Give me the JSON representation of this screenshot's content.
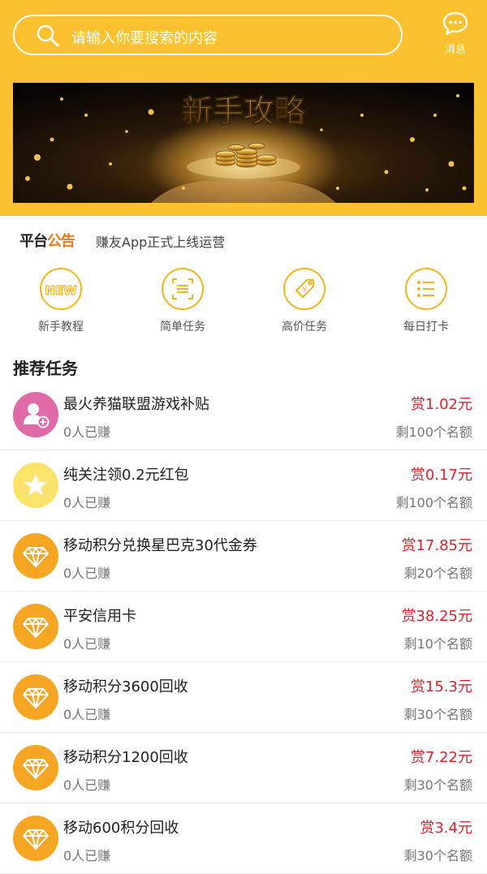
{
  "search": {
    "placeholder": "请输入你要搜索的内容"
  },
  "header": {
    "message_label": "消息"
  },
  "banner": {
    "title": "新手攻略"
  },
  "notice": {
    "logo_part1": "平台",
    "logo_part2": "公告",
    "text": "赚友App正式上线运营"
  },
  "quick_actions": [
    {
      "label": "新手教程",
      "icon": "new-icon"
    },
    {
      "label": "简单任务",
      "icon": "scan-icon"
    },
    {
      "label": "高价任务",
      "icon": "price-tag-icon"
    },
    {
      "label": "每日打卡",
      "icon": "list-icon"
    }
  ],
  "section": {
    "title": "推荐任务"
  },
  "tasks": [
    {
      "title": "最火养猫联盟游戏补贴",
      "earned": "0人已赚",
      "reward": "赏1.02元",
      "remaining": "剩100个名额",
      "icon": "add-user-icon",
      "icon_color": "#e06aa8"
    },
    {
      "title": "纯关注领0.2元红包",
      "earned": "0人已赚",
      "reward": "赏0.17元",
      "remaining": "剩100个名额",
      "icon": "star-icon",
      "icon_color": "#fbe36b"
    },
    {
      "title": "移动积分兑换星巴克30代金券",
      "earned": "0人已赚",
      "reward": "赏17.85元",
      "remaining": "剩20个名额",
      "icon": "diamond-icon",
      "icon_color": "#f6a623"
    },
    {
      "title": "平安信用卡",
      "earned": "0人已赚",
      "reward": "赏38.25元",
      "remaining": "剩10个名额",
      "icon": "diamond-icon",
      "icon_color": "#f6a623"
    },
    {
      "title": "移动积分3600回收",
      "earned": "0人已赚",
      "reward": "赏15.3元",
      "remaining": "剩30个名额",
      "icon": "diamond-icon",
      "icon_color": "#f6a623"
    },
    {
      "title": "移动积分1200回收",
      "earned": "0人已赚",
      "reward": "赏7.22元",
      "remaining": "剩30个名额",
      "icon": "diamond-icon",
      "icon_color": "#f6a623"
    },
    {
      "title": "移动600积分回收",
      "earned": "0人已赚",
      "reward": "赏3.4元",
      "remaining": "剩30个名额",
      "icon": "diamond-icon",
      "icon_color": "#f6a623"
    }
  ],
  "colors": {
    "brand": "#fbc12f",
    "reward": "#e8202a",
    "accent": "#f5b51a"
  }
}
